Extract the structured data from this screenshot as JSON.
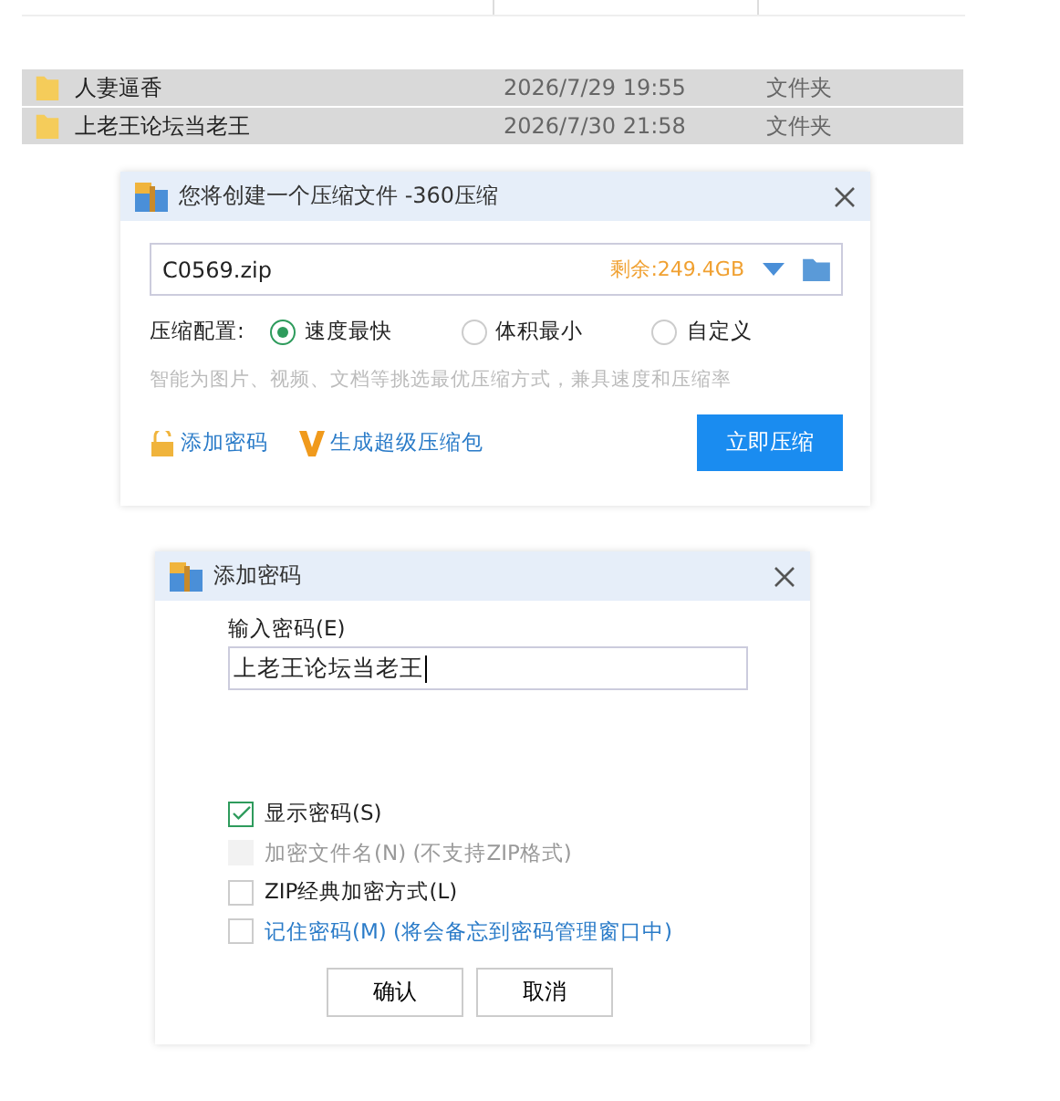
{
  "file_list": {
    "rows": [
      {
        "name": "人妻逼香",
        "modified": "2026/7/29 19:55",
        "type": "文件夹",
        "selected": true
      },
      {
        "name": "上老王论坛当老王",
        "modified": "2026/7/30 21:58",
        "type": "文件夹",
        "selected": true
      }
    ]
  },
  "compress_dialog": {
    "title": "您将创建一个压缩文件 -360压缩",
    "filename": "C0569.zip",
    "free_space": "剩余:249.4GB",
    "config_label": "压缩配置:",
    "options": [
      {
        "label": "速度最快",
        "selected": true
      },
      {
        "label": "体积最小",
        "selected": false
      },
      {
        "label": "自定义",
        "selected": false
      }
    ],
    "hint": "智能为图片、视频、文档等挑选最优压缩方式，兼具速度和压缩率",
    "add_password": "添加密码",
    "super_package": "生成超级压缩包",
    "compress_button": "立即压缩"
  },
  "password_dialog": {
    "title": "添加密码",
    "field_label": "输入密码(E)",
    "password": "上老王论坛当老王",
    "checkboxes": [
      {
        "label": "显示密码(S)",
        "checked": true,
        "disabled": false,
        "kind": "plain"
      },
      {
        "label": "加密文件名(N) (不支持ZIP格式)",
        "checked": false,
        "disabled": true,
        "kind": "plain"
      },
      {
        "label": "ZIP经典加密方式(L)",
        "checked": false,
        "disabled": false,
        "kind": "plain"
      },
      {
        "label": "记住密码(M) (将会备忘到密码管理窗口中)",
        "checked": false,
        "disabled": false,
        "kind": "link"
      }
    ],
    "buttons": [
      "确认",
      "取消"
    ]
  }
}
